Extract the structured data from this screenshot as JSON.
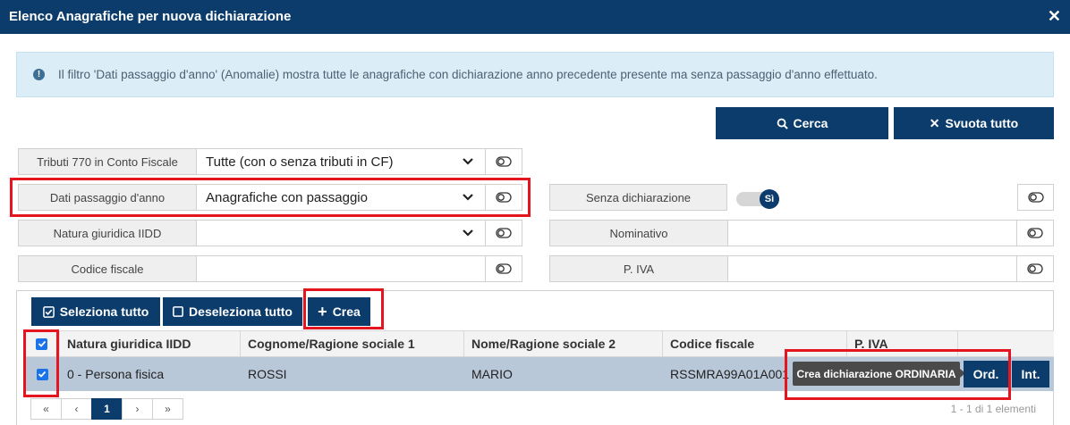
{
  "dialog": {
    "title": "Elenco Anagrafiche per nuova dichiarazione"
  },
  "info": {
    "text": "Il filtro 'Dati passaggio d'anno' (Anomalie) mostra tutte le anagrafiche con dichiarazione anno precedente presente ma senza passaggio d'anno effettuato."
  },
  "actions": {
    "search": "Cerca",
    "clear": "Svuota tutto"
  },
  "filters": {
    "tributi": {
      "label": "Tributi 770 in Conto Fiscale",
      "value": "Tutte (con o senza tributi in CF)"
    },
    "passaggio": {
      "label": "Dati passaggio d'anno",
      "value": "Anagrafiche con passaggio"
    },
    "natura": {
      "label": "Natura giuridica IIDD",
      "value": ""
    },
    "codice": {
      "label": "Codice fiscale",
      "value": ""
    },
    "senza_dich": {
      "label": "Senza dichiarazione",
      "toggle": "Sì"
    },
    "nominativo": {
      "label": "Nominativo",
      "value": ""
    },
    "piva": {
      "label": "P. IVA",
      "value": ""
    }
  },
  "toolbar": {
    "select_all": "Seleziona tutto",
    "deselect_all": "Deseleziona tutto",
    "create": "Crea"
  },
  "table": {
    "headers": [
      "Natura giuridica IIDD",
      "Cognome/Ragione sociale 1",
      "Nome/Ragione sociale 2",
      "Codice fiscale",
      "P. IVA"
    ],
    "rows": [
      {
        "natura": "0 - Persona fisica",
        "cognome": "ROSSI",
        "nome": "MARIO",
        "cf": "RSSMRA99A01A001",
        "piva": ""
      }
    ],
    "row_actions": {
      "ord": "Ord.",
      "int": "Int.",
      "tooltip": "Crea dichiarazione ORDINARIA"
    }
  },
  "pager": {
    "first": "«",
    "prev": "‹",
    "page": "1",
    "next": "›",
    "last": "»",
    "info": "1 - 1 di 1 elementi"
  },
  "colors": {
    "primary": "#0b3c6b",
    "highlight": "#e4151f",
    "row_selected": "#b9c8d9",
    "info_bg": "#dbedf6"
  }
}
